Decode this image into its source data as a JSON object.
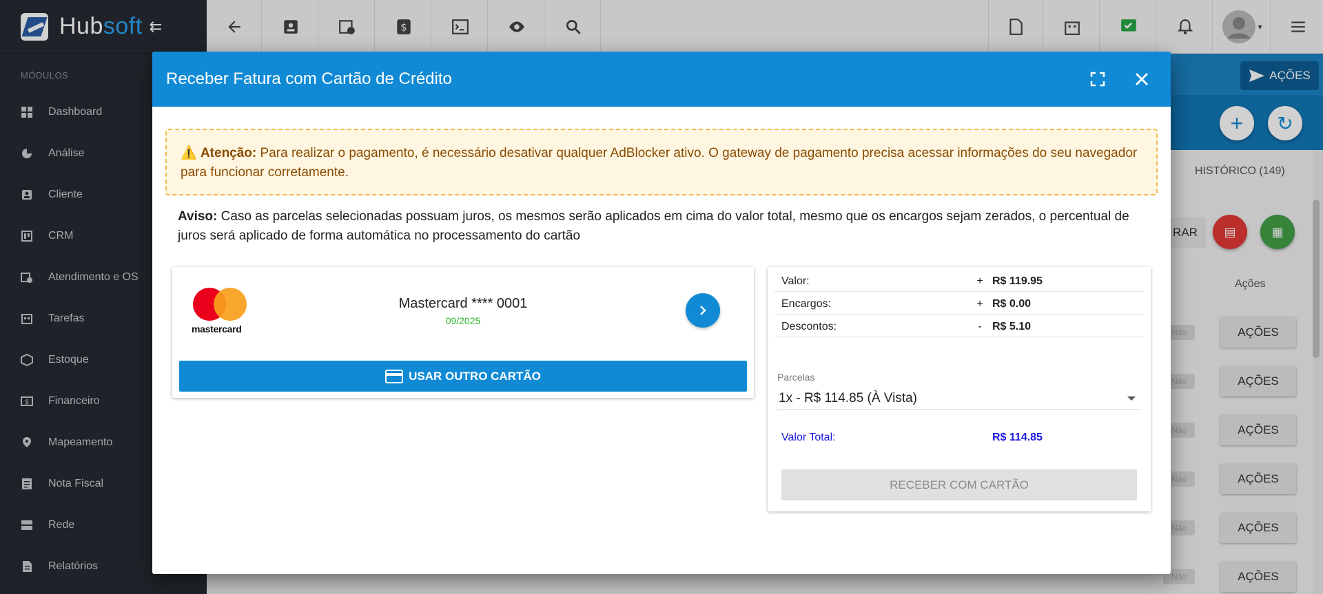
{
  "app": {
    "brand_primary": "Hub",
    "brand_secondary": "soft",
    "accent_color": "#118ad6"
  },
  "sidebar": {
    "section_label": "MÓDULOS",
    "items": [
      {
        "label": "Dashboard",
        "icon": "dashboard-icon"
      },
      {
        "label": "Análise",
        "icon": "pie-chart-icon"
      },
      {
        "label": "Cliente",
        "icon": "contact-card-icon"
      },
      {
        "label": "CRM",
        "icon": "board-icon"
      },
      {
        "label": "Atendimento e OS",
        "icon": "calendar-clock-icon"
      },
      {
        "label": "Tarefas",
        "icon": "tasks-icon"
      },
      {
        "label": "Estoque",
        "icon": "box-icon"
      },
      {
        "label": "Financeiro",
        "icon": "money-icon"
      },
      {
        "label": "Mapeamento",
        "icon": "map-pin-icon"
      },
      {
        "label": "Nota Fiscal",
        "icon": "invoice-icon"
      },
      {
        "label": "Rede",
        "icon": "server-icon"
      },
      {
        "label": "Relatórios",
        "icon": "report-icon"
      }
    ]
  },
  "background": {
    "acoes_top": "AÇÕES",
    "historico": "HISTÓRICO (149)",
    "filtrar": "RAR",
    "col_acoes": "Ações",
    "row_action": "AÇÕES",
    "nao": "Não"
  },
  "modal": {
    "title": "Receber Fatura com Cartão de Crédito",
    "alert_strong": "Atenção:",
    "alert_text": " Para realizar o pagamento, é necessário desativar qualquer AdBlocker ativo. O gateway de pagamento precisa acessar informações do seu navegador para funcionar corretamente.",
    "aviso_strong": "Aviso:",
    "aviso_text": " Caso as parcelas selecionadas possuam juros, os mesmos serão aplicados em cima do valor total, mesmo que os encargos sejam zerados, o percentual de juros será aplicado de forma automática no processamento do cartão",
    "card": {
      "brand_word": "mastercard",
      "name": "Mastercard **** 0001",
      "expiry": "09/2025",
      "other_card_label": "USAR OUTRO CARTÃO"
    },
    "summary": {
      "rows": [
        {
          "label": "Valor:",
          "sign": "+",
          "value": "R$ 119.95"
        },
        {
          "label": "Encargos:",
          "sign": "+",
          "value": "R$ 0.00"
        },
        {
          "label": "Descontos:",
          "sign": "-",
          "value": "R$ 5.10"
        }
      ],
      "parcelas_label": "Parcelas",
      "parcelas_value": "1x - R$ 114.85 (À Vista)",
      "total_label": "Valor Total:",
      "total_value": "R$ 114.85",
      "receber_label": "RECEBER COM CARTÃO"
    }
  }
}
